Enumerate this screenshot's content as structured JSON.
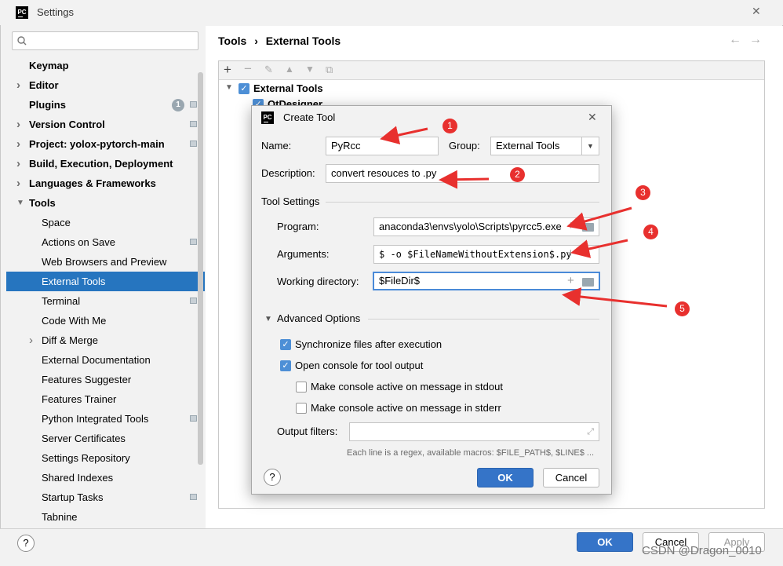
{
  "window": {
    "title": "Settings",
    "close": "✕"
  },
  "search": {
    "placeholder": ""
  },
  "sidebar": {
    "items": [
      {
        "label": "Keymap"
      },
      {
        "label": "Editor"
      },
      {
        "label": "Plugins",
        "badge": "1"
      },
      {
        "label": "Version Control"
      },
      {
        "label": "Project: yolox-pytorch-main"
      },
      {
        "label": "Build, Execution, Deployment"
      },
      {
        "label": "Languages & Frameworks"
      },
      {
        "label": "Tools"
      },
      {
        "label": "Space"
      },
      {
        "label": "Actions on Save"
      },
      {
        "label": "Web Browsers and Preview"
      },
      {
        "label": "External Tools"
      },
      {
        "label": "Terminal"
      },
      {
        "label": "Code With Me"
      },
      {
        "label": "Diff & Merge"
      },
      {
        "label": "External Documentation"
      },
      {
        "label": "Features Suggester"
      },
      {
        "label": "Features Trainer"
      },
      {
        "label": "Python Integrated Tools"
      },
      {
        "label": "Server Certificates"
      },
      {
        "label": "Settings Repository"
      },
      {
        "label": "Shared Indexes"
      },
      {
        "label": "Startup Tasks"
      },
      {
        "label": "Tabnine"
      }
    ]
  },
  "breadcrumb": {
    "parent": "Tools",
    "sep": "›",
    "current": "External Tools"
  },
  "tree": {
    "group": "External Tools",
    "child": "QtDesigner"
  },
  "footer": {
    "help": "?",
    "ok": "OK",
    "cancel": "Cancel",
    "apply": "Apply"
  },
  "dialog": {
    "title": "Create Tool",
    "name_label": "Name:",
    "name_value": "PyRcc",
    "group_label": "Group:",
    "group_value": "External Tools",
    "description_label": "Description:",
    "description_value": "convert resouces to .py",
    "tool_settings": "Tool Settings",
    "program_label": "Program:",
    "program_value": "anaconda3\\envs\\yolo\\Scripts\\pyrcc5.exe",
    "arguments_label": "Arguments:",
    "arguments_value": "$ -o $FileNameWithoutExtension$.py",
    "workdir_label": "Working directory:",
    "workdir_value": "$FileDir$",
    "advanced": "Advanced Options",
    "sync_label": "Synchronize files after execution",
    "console_label": "Open console for tool output",
    "stdout_label": "Make console active on message in stdout",
    "stderr_label": "Make console active on message in stderr",
    "filters_label": "Output filters:",
    "hint": "Each line is a regex, available macros: $FILE_PATH$, $LINE$ ...",
    "help": "?",
    "ok": "OK",
    "cancel": "Cancel"
  },
  "annotations": [
    "1",
    "2",
    "3",
    "4",
    "5"
  ],
  "watermark": "CSDN @Dragon_0010",
  "colors": {
    "accent": "#2675bf",
    "annotation": "#e8302e"
  }
}
